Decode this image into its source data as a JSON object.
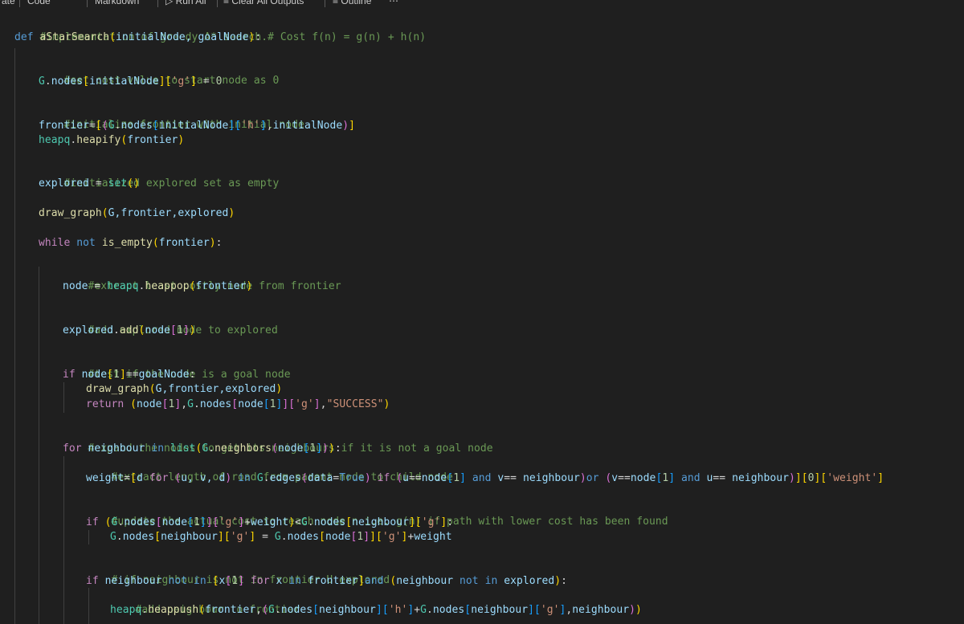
{
  "toolbar": {
    "item0": "rate",
    "item1": "Code",
    "item2": "Markdown",
    "item3": "Run All",
    "item4": "Clear All Outputs",
    "item5": "Outline"
  },
  "code": {
    "l1": "#implementation of greedy A* search.",
    "l2_def": "def",
    "l2_name": "aStarSearch",
    "l2_params": "initialNode, goalNode",
    "l2_cmt": "# Cost f(n) = g(n) + h(n)",
    "l3": "#set cost value to start node as 0",
    "l4_G": "G",
    "l4_nodes": "nodes",
    "l4_key": "initialNode",
    "l4_str": "'g'",
    "l4_val": "0",
    "l5": "#initialize frontier with initial node",
    "l6_frontier": "frontier",
    "l6_G": "G",
    "l6_nodes": "nodes",
    "l6_key": "initialNode",
    "l6_str": "'h'",
    "l6_init": "initialNode",
    "l7_heapq": "heapq",
    "l7_fn": "heapify",
    "l7_arg": "frontier",
    "l8": "#initialized explored set as empty",
    "l9_var": "explored",
    "l9_fn": "set",
    "l10_fn": "draw_graph",
    "l10_args": "G,frontier,explored",
    "l11_kw": "while",
    "l11_not": "not",
    "l11_fn": "is_empty",
    "l11_arg": "frontier",
    "l12": "#extract least costly node from frontier",
    "l13_var": "node",
    "l13_heapq": "heapq",
    "l13_fn": "heappop",
    "l13_arg": "frontier",
    "l14": "#add explored node to explored",
    "l15_var": "explored",
    "l15_fn": "add",
    "l15_node": "node",
    "l15_idx": "1",
    "l16": "#test if the node is a goal node",
    "l17_if": "if",
    "l17_node": "node",
    "l17_idx": "1",
    "l17_goal": "goalNode",
    "l18_fn": "draw_graph",
    "l18_args": "G,frontier,explored",
    "l19_ret": "return",
    "l19_node": "node",
    "l19_idx": "1",
    "l19_G": "G",
    "l19_nodes": "nodes",
    "l19_node2": "node",
    "l19_idx2": "1",
    "l19_str": "'g'",
    "l19_succ": "\"SUCCESS\"",
    "l20": "#expand the nodes to get its neighbours if it is not a goal node",
    "l21_for": "for",
    "l21_var": "neighbour",
    "l21_in": "in",
    "l21_list": "list",
    "l21_G": "G",
    "l21_fn": "neighbors",
    "l21_node": "node",
    "l21_idx": "1",
    "l22": "#extract length of road from parent node to child node",
    "l23_weight": "weight",
    "l23_d": "d",
    "l23_for": "for",
    "l23_uvd": "u, v, d",
    "l23_in": "in",
    "l23_G": "G",
    "l23_edges": "edges",
    "l23_data": "data",
    "l23_true": "True",
    "l23_if": "if",
    "l23_u": "u",
    "l23_node": "node",
    "l23_idx": "1",
    "l23_and": "and",
    "l23_v": "v",
    "l23_nb": "neighbour",
    "l23_or": "or",
    "l23_v2": "v",
    "l23_node2": "node",
    "l23_idx2": "1",
    "l23_and2": "and",
    "l23_u2": "u",
    "l23_nb2": "neighbour",
    "l23_zero": "0",
    "l23_str": "'weight'",
    "l24": "#update the actual cost to reach node n i.e. g(n) if path with lower cost has been found",
    "l25_if": "if",
    "l25_G": "G",
    "l25_nodes": "nodes",
    "l25_node": "node",
    "l25_idx": "1",
    "l25_str": "'g'",
    "l25_weight": "weight",
    "l25_G2": "G",
    "l25_nodes2": "nodes",
    "l25_nb": "neighbour",
    "l25_str2": "'g'",
    "l26_G": "G",
    "l26_nodes": "nodes",
    "l26_nb": "neighbour",
    "l26_str": "'g'",
    "l26_G2": "G",
    "l26_nodes2": "nodes",
    "l26_node": "node",
    "l26_idx": "1",
    "l26_str2": "'g'",
    "l26_weight": "weight",
    "l27": "# if neighbour is not in frontier U explored",
    "l28_if": "if",
    "l28_nb": "neighbour",
    "l28_not": "not",
    "l28_in": "in",
    "l28_x": "x",
    "l28_idx": "1",
    "l28_for": "for",
    "l28_x2": "x",
    "l28_in2": "in",
    "l28_frontier": "frontier",
    "l28_and": "and",
    "l28_nb2": "neighbour",
    "l28_not2": "not",
    "l28_in3": "in",
    "l28_explored": "explored",
    "l29": "#add neighbour to frontier",
    "l30_heapq": "heapq",
    "l30_fn": "heappush",
    "l30_frontier": "frontier",
    "l30_G": "G",
    "l30_nodes": "nodes",
    "l30_nb": "neighbour",
    "l30_str": "'h'",
    "l30_G2": "G",
    "l30_nodes2": "nodes",
    "l30_nb2": "neighbour",
    "l30_str2": "'g'",
    "l30_nb3": "neighbour"
  }
}
